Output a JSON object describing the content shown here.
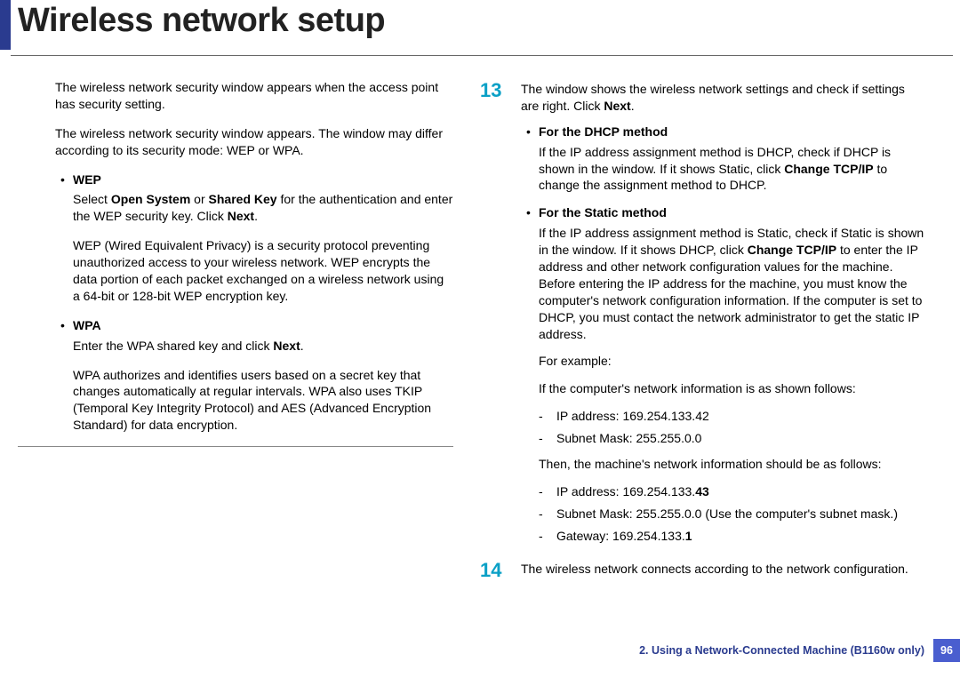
{
  "title": "Wireless network setup",
  "left": {
    "intro1": "The wireless network security window appears when the access point has security setting.",
    "intro2": "The wireless network security window appears. The window may differ according to its security mode: WEP or WPA.",
    "wep": {
      "label": "WEP",
      "line1_pre": "Select ",
      "line1_b1": "Open System",
      "line1_mid": " or ",
      "line1_b2": "Shared Key",
      "line1_post": " for the authentication and enter the WEP security key. Click ",
      "line1_b3": "Next",
      "line1_end": ".",
      "line2": "WEP (Wired Equivalent Privacy) is a security protocol preventing unauthorized access to your wireless network. WEP encrypts the data portion of each packet exchanged on a wireless network using a 64-bit or 128-bit WEP encryption key."
    },
    "wpa": {
      "label": "WPA",
      "line1_pre": "Enter the WPA shared key and click ",
      "line1_b1": "Next",
      "line1_end": ".",
      "line2": "WPA authorizes and identifies users based on a secret key that changes automatically at regular intervals. WPA also uses TKIP (Temporal Key Integrity Protocol) and AES (Advanced Encryption Standard) for data encryption."
    }
  },
  "right": {
    "step13": {
      "num": "13",
      "p1_pre": "The window shows the wireless network settings and check if settings are right. Click ",
      "p1_b": "Next",
      "p1_end": ".",
      "dhcp": {
        "label": "For the DHCP method",
        "body_pre": "If the IP address assignment method is DHCP, check if DHCP is shown in the window. If it shows Static, click ",
        "body_b": "Change TCP/IP",
        "body_post": " to change the assignment method to DHCP."
      },
      "static": {
        "label": "For the Static method",
        "body_pre": "If the IP address assignment method is Static, check if Static is shown in the window. If it shows DHCP, click ",
        "body_b": "Change TCP/IP",
        "body_post": " to enter the IP address and other network configuration values for the machine. Before entering the IP address for the machine, you must know the computer's network configuration information. If the computer is set to DHCP, you must contact the network administrator to get the static IP address.",
        "example_label": "For example:",
        "example_intro": "If the computer's network information is as shown follows:",
        "ex1": "IP address: 169.254.133.42",
        "ex2": "Subnet Mask: 255.255.0.0",
        "then": "Then, the machine's network information should be as follows:",
        "m1_pre": "IP address: 169.254.133.",
        "m1_b": "43",
        "m2": "Subnet Mask: 255.255.0.0 (Use the computer's subnet mask.)",
        "m3_pre": "Gateway: 169.254.133.",
        "m3_b": "1"
      }
    },
    "step14": {
      "num": "14",
      "body": "The wireless network connects according to the network configuration."
    }
  },
  "footer": {
    "text": "2.  Using a Network-Connected Machine (B1160w only)",
    "page": "96"
  }
}
